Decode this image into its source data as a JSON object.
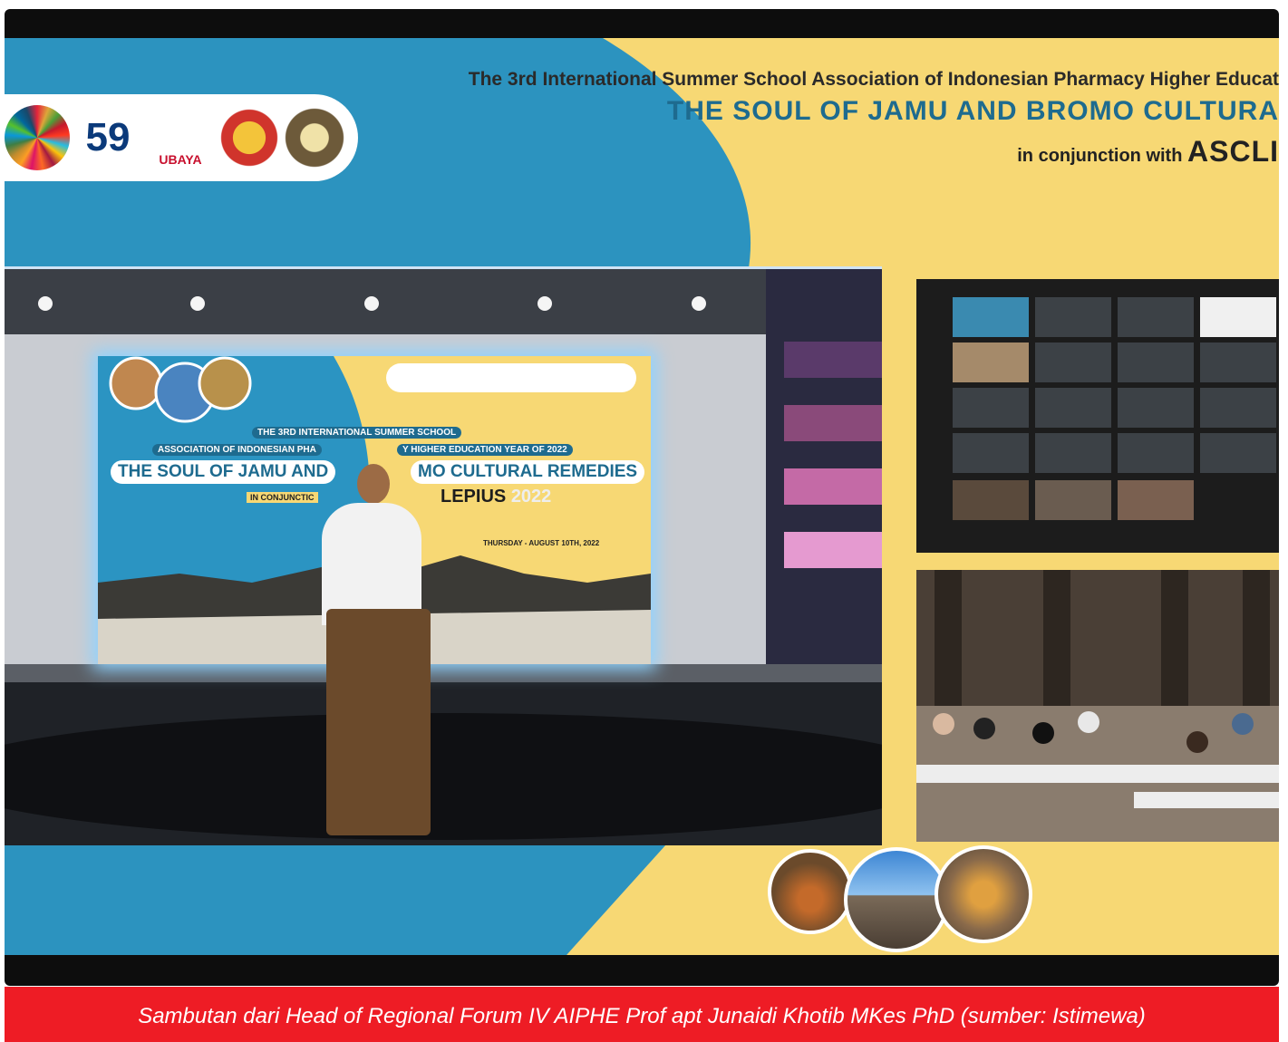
{
  "scene": {
    "header_line1": "The 3rd International Summer School Association of Indonesian Pharmacy Higher Educat",
    "header_line2": "THE SOUL OF JAMU AND BROMO CULTURA",
    "header_line3_prefix": "in conjunction with",
    "header_line3_brand": "ASCLI",
    "logo_text_ubaya": "UBAYA",
    "screen_line1": "THE 3RD INTERNATIONAL SUMMER SCHOOL",
    "screen_line2": "ASSOCIATION OF INDONESIAN PHA",
    "screen_line2b": "Y HIGHER EDUCATION YEAR OF 2022",
    "screen_title_a": "THE SOUL OF JAMU AND",
    "screen_title_b": "MO CULTURAL REMEDIES",
    "screen_conj": "IN CONJUNCTIC",
    "screen_brand": "LEPIUS",
    "screen_year": "2022",
    "screen_date": "THURSDAY - AUGUST 10TH, 2022"
  },
  "caption": {
    "text": "Sambutan dari Head of Regional Forum IV AIPHE Prof apt Junaidi Khotib MKes PhD (sumber: Istimewa)"
  },
  "colors": {
    "blue": "#2c93bf",
    "yellow": "#f7d874",
    "caption_red": "#ee1c25"
  }
}
